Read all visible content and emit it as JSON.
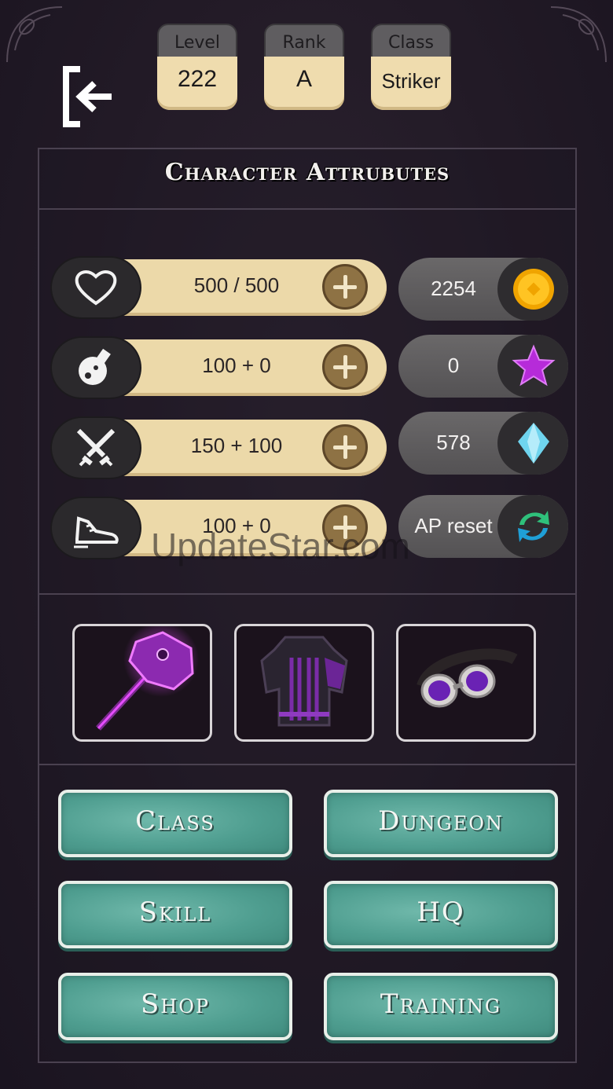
{
  "header": {
    "level": {
      "label": "Level",
      "value": "222"
    },
    "rank": {
      "label": "Rank",
      "value": "A"
    },
    "class": {
      "label": "Class",
      "value": "Striker"
    }
  },
  "panel": {
    "title": "Character Attrubutes"
  },
  "attributes": [
    {
      "icon": "heart-icon",
      "value": "500 / 500"
    },
    {
      "icon": "potion-icon",
      "value": "100 + 0"
    },
    {
      "icon": "crossed-swords-icon",
      "value": "150 + 100"
    },
    {
      "icon": "sneaker-icon",
      "value": "100 + 0"
    }
  ],
  "currencies": [
    {
      "icon": "gold-coin-icon",
      "value": "2254",
      "color": "#f3b21a"
    },
    {
      "icon": "star-icon",
      "value": "0",
      "color": "#b62bd9"
    },
    {
      "icon": "diamond-icon",
      "value": "578",
      "color": "#6fd4ee"
    },
    {
      "icon": "refresh-icon",
      "value": "AP reset",
      "color": "#2fc07b"
    }
  ],
  "equipment": [
    {
      "icon": "purple-hammer-icon"
    },
    {
      "icon": "purple-armor-icon"
    },
    {
      "icon": "goggles-icon"
    }
  ],
  "menu": {
    "class": "Class",
    "dungeon": "Dungeon",
    "skill": "Skill",
    "hq": "HQ",
    "shop": "Shop",
    "training": "Training"
  },
  "watermark": "UpdateStar.com",
  "colors": {
    "background": "#221a26",
    "parchment": "#ecd9a9",
    "teal_button": "#4f9e90",
    "plus_button": "#8e7244"
  }
}
